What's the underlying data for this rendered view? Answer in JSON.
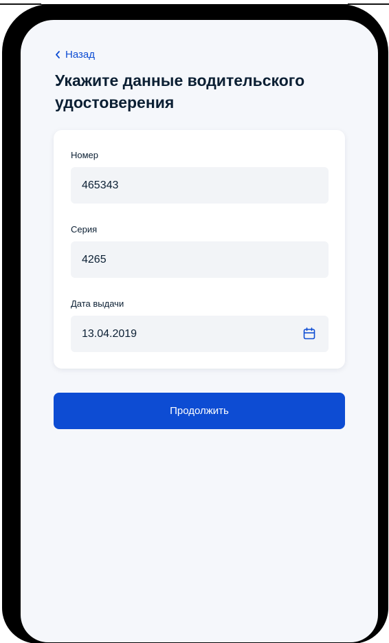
{
  "header": {
    "back_label": "Назад"
  },
  "page": {
    "title": "Укажите данные водительского удостоверения"
  },
  "form": {
    "number": {
      "label": "Номер",
      "value": "465343"
    },
    "series": {
      "label": "Серия",
      "value": "4265"
    },
    "issue_date": {
      "label": "Дата выдачи",
      "value": "13.04.2019",
      "icon": "calendar-icon"
    }
  },
  "actions": {
    "continue_label": "Продолжить"
  },
  "colors": {
    "accent": "#0d4cd3",
    "background": "#f5f7fb",
    "field": "#f2f4f7",
    "text": "#0b1f33"
  }
}
